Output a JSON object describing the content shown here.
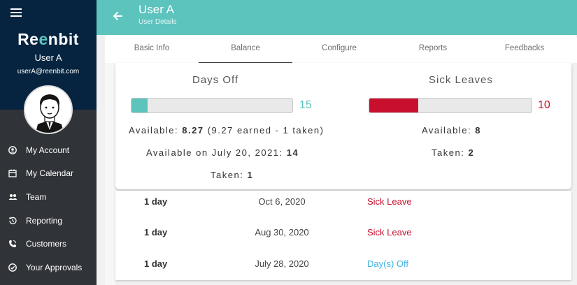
{
  "sidebar": {
    "logo": {
      "pre": "Re",
      "accent": "e",
      "post": "nbit"
    },
    "user_name": "User A",
    "user_email": "userA@reenbit.com",
    "items": [
      {
        "label": "My Account",
        "icon": "account-icon"
      },
      {
        "label": "My Calendar",
        "icon": "calendar-icon"
      },
      {
        "label": "Team",
        "icon": "team-icon"
      },
      {
        "label": "Reporting",
        "icon": "history-icon"
      },
      {
        "label": "Customers",
        "icon": "phone-icon"
      },
      {
        "label": "Your Approvals",
        "icon": "check-circle-icon"
      }
    ]
  },
  "header": {
    "title": "User A",
    "subtitle": "User Details"
  },
  "tabs": [
    {
      "label": "Basic Info"
    },
    {
      "label": "Balance",
      "active": true
    },
    {
      "label": "Configure"
    },
    {
      "label": "Reports"
    },
    {
      "label": "Feedbacks"
    }
  ],
  "balance": {
    "days_off": {
      "title": "Days Off",
      "count": "15",
      "fill_fraction": 0.1,
      "color": "#5cc3bd",
      "available_label": "Available:",
      "available_value": "8.27",
      "available_detail": "(9.27 earned - 1 taken)",
      "available_on_label": "Available on July 20, 2021:",
      "available_on_value": "14",
      "taken_label": "Taken:",
      "taken_value": "1"
    },
    "sick_leaves": {
      "title": "Sick Leaves",
      "count": "10",
      "fill_fraction": 0.3,
      "color": "#c8102e",
      "available_label": "Available:",
      "available_value": "8",
      "taken_label": "Taken:",
      "taken_value": "2"
    }
  },
  "entries": [
    {
      "duration": "1 day",
      "date": "Oct 6, 2020",
      "type": "Sick Leave",
      "type_color": "#c8102e"
    },
    {
      "duration": "1 day",
      "date": "Aug 30, 2020",
      "type": "Sick Leave",
      "type_color": "#c8102e"
    },
    {
      "duration": "1 day",
      "date": "July 28, 2020",
      "type": "Day(s) Off",
      "type_color": "#3db3e3"
    }
  ]
}
